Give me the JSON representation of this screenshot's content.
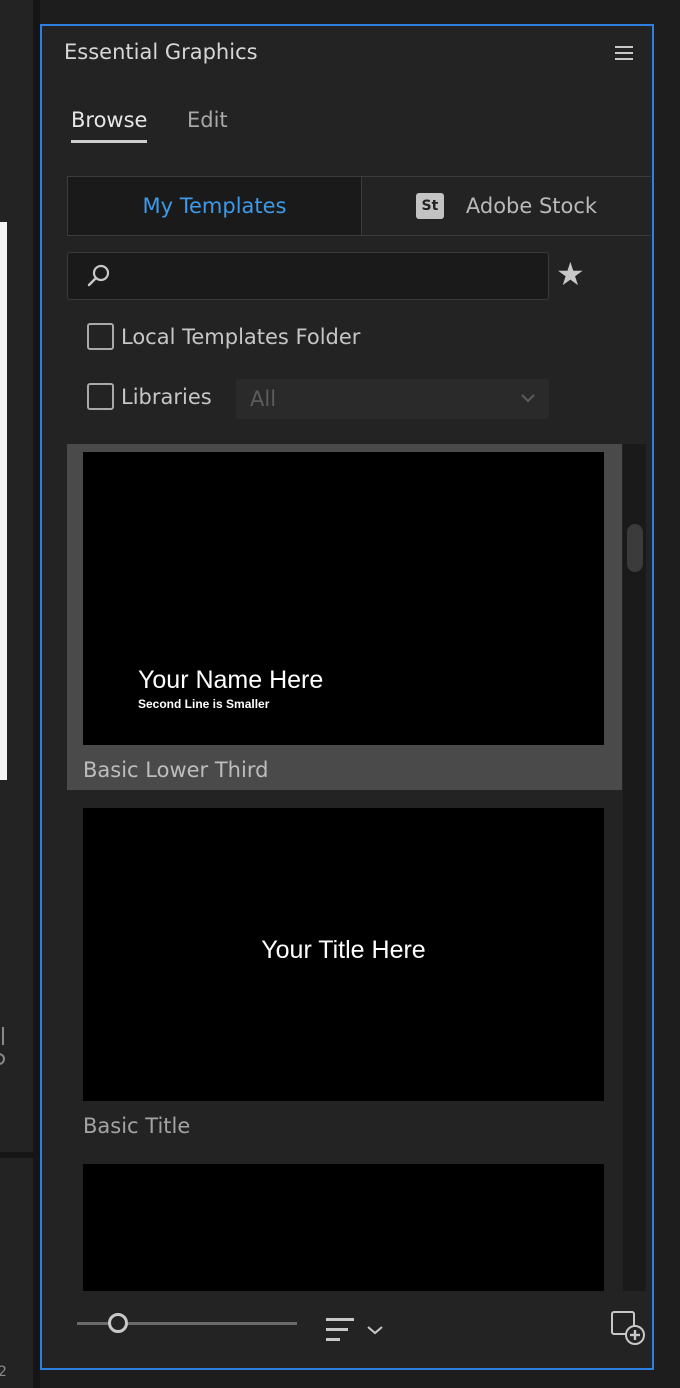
{
  "panel": {
    "title": "Essential Graphics",
    "menu_icon": "hamburger-menu-icon",
    "accent_color": "#2d7fe0"
  },
  "tabs": [
    {
      "label": "Browse",
      "active": true
    },
    {
      "label": "Edit",
      "active": false
    }
  ],
  "source_toggle": {
    "my_templates": "My Templates",
    "adobe_stock_badge": "St",
    "adobe_stock": "Adobe Stock",
    "active_color": "#3d9ae8"
  },
  "search": {
    "placeholder": "",
    "value": ""
  },
  "filters": {
    "local_templates_folder": {
      "label": "Local Templates Folder",
      "checked": false
    },
    "libraries": {
      "label": "Libraries",
      "checked": false
    },
    "libraries_dropdown": "All"
  },
  "templates": [
    {
      "name": "Basic Lower Third",
      "preview_line1": "Your Name Here",
      "preview_line2": "Second Line is Smaller",
      "selected": true
    },
    {
      "name": "Basic Title",
      "preview_title": "Your Title Here",
      "selected": false
    },
    {
      "name": "",
      "selected": false
    }
  ],
  "background_left": {
    "number": "2"
  }
}
